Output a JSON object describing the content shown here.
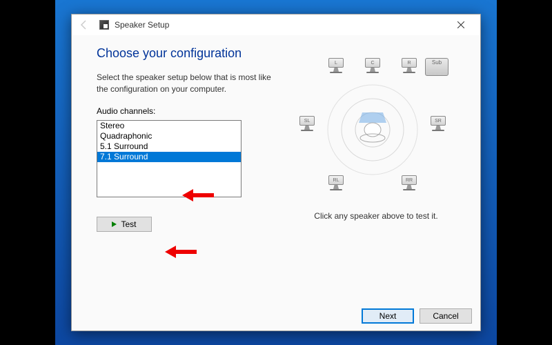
{
  "window": {
    "title": "Speaker Setup"
  },
  "header": {
    "pageTitle": "Choose your configuration",
    "instruction": "Select the speaker setup below that is most like the configuration on your computer."
  },
  "listLabel": "Audio channels:",
  "channels": [
    {
      "label": "Stereo",
      "selected": false
    },
    {
      "label": "Quadraphonic",
      "selected": false
    },
    {
      "label": "5.1 Surround",
      "selected": false
    },
    {
      "label": "7.1 Surround",
      "selected": true
    }
  ],
  "testButton": "Test",
  "speakers": {
    "L": "L",
    "C": "C",
    "R": "R",
    "SL": "SL",
    "SR": "SR",
    "RL": "RL",
    "RR": "RR",
    "SUB": "Sub"
  },
  "speakerCaption": "Click any speaker above to test it.",
  "buttons": {
    "next": "Next",
    "cancel": "Cancel"
  }
}
